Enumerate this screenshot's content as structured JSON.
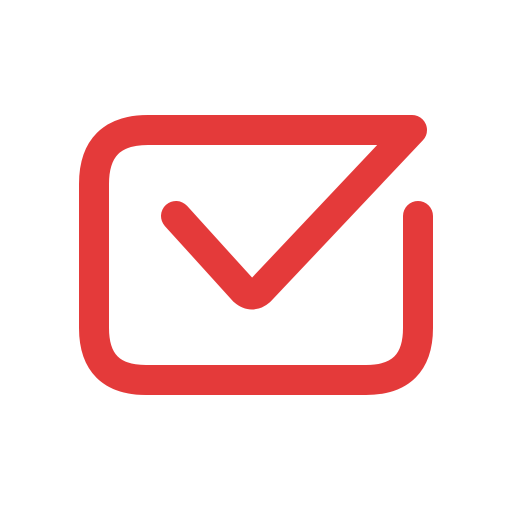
{
  "logo": {
    "icon": "envelope-check-icon",
    "color": "#e43a3a",
    "background": "#ffffff"
  }
}
